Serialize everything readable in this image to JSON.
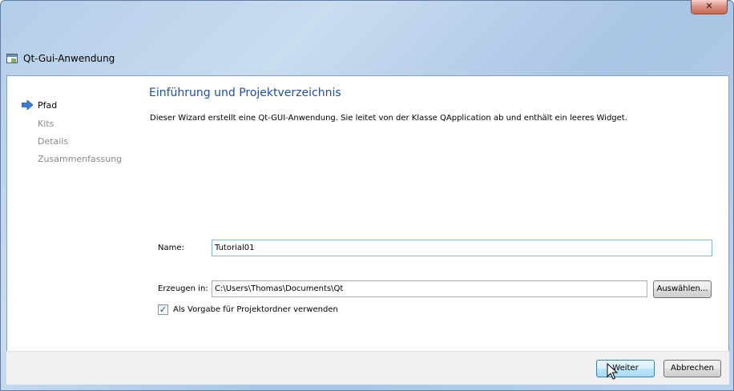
{
  "window": {
    "title": "Qt-Gui-Anwendung",
    "close_glyph": "✕"
  },
  "sidebar": {
    "items": [
      {
        "label": "Pfad",
        "active": true
      },
      {
        "label": "Kits",
        "active": false
      },
      {
        "label": "Details",
        "active": false
      },
      {
        "label": "Zusammenfassung",
        "active": false
      }
    ]
  },
  "page": {
    "title": "Einführung und Projektverzeichnis",
    "description": "Dieser Wizard erstellt eine Qt-GUI-Anwendung. Sie leitet von der Klasse QApplication ab und enthält ein leeres Widget."
  },
  "form": {
    "name_label": "Name:",
    "name_value": "Tutorial01",
    "create_in_label": "Erzeugen in:",
    "create_in_value": "C:\\Users\\Thomas\\Documents\\Qt",
    "browse_button": "Auswählen...",
    "default_checkbox_label": "Als Vorgabe für Projektordner verwenden",
    "default_checkbox_checked": true,
    "check_glyph": "✓"
  },
  "footer": {
    "next_button": "Weiter",
    "cancel_button": "Abbrechen"
  },
  "colors": {
    "title_blue": "#1f4e9a",
    "inactive_gray": "#8a8a8a",
    "arrow_blue": "#3b7fd0"
  }
}
